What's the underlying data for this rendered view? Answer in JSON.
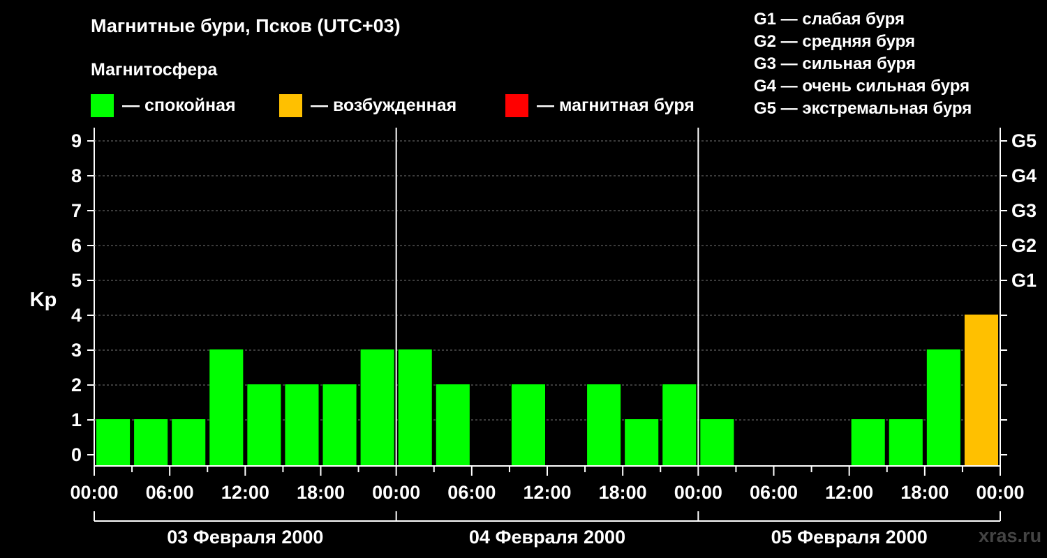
{
  "title": "Магнитные бури, Псков (UTC+03)",
  "subtitle": "Магнитосфера",
  "legend": [
    {
      "label": "— спокойная",
      "color": "#00ff00"
    },
    {
      "label": "— возбужденная",
      "color": "#ffc000"
    },
    {
      "label": "— магнитная буря",
      "color": "#ff0000"
    }
  ],
  "g_legend": [
    "G1 — слабая буря",
    "G2 — средняя буря",
    "G3 — сильная буря",
    "G4 — очень сильная буря",
    "G5 — экстремальная буря"
  ],
  "watermark": "xras.ru",
  "chart_data": {
    "type": "bar",
    "ylabel": "Kp",
    "ylim": [
      0,
      9
    ],
    "y_ticks": [
      "0",
      "1",
      "2",
      "3",
      "4",
      "5",
      "6",
      "7",
      "8",
      "9"
    ],
    "g_ticks": [
      {
        "value": 5,
        "label": "G1"
      },
      {
        "value": 6,
        "label": "G2"
      },
      {
        "value": 7,
        "label": "G3"
      },
      {
        "value": 8,
        "label": "G4"
      },
      {
        "value": 9,
        "label": "G5"
      }
    ],
    "x_tick_labels": [
      "00:00",
      "06:00",
      "12:00",
      "18:00",
      "00:00",
      "06:00",
      "12:00",
      "18:00",
      "00:00",
      "06:00",
      "12:00",
      "18:00",
      "00:00"
    ],
    "days": [
      "03 Февраля 2000",
      "04 Февраля 2000",
      "05 Февраля 2000"
    ],
    "interval_hours": 3,
    "values": [
      1,
      1,
      1,
      3,
      2,
      2,
      2,
      3,
      3,
      2,
      0,
      2,
      0,
      2,
      1,
      2,
      1,
      0,
      0,
      0,
      1,
      1,
      3,
      4
    ],
    "colors": [
      "#00ff00",
      "#00ff00",
      "#00ff00",
      "#00ff00",
      "#00ff00",
      "#00ff00",
      "#00ff00",
      "#00ff00",
      "#00ff00",
      "#00ff00",
      "#00ff00",
      "#00ff00",
      "#00ff00",
      "#00ff00",
      "#00ff00",
      "#00ff00",
      "#00ff00",
      "#00ff00",
      "#00ff00",
      "#00ff00",
      "#00ff00",
      "#00ff00",
      "#00ff00",
      "#ffc000"
    ],
    "grid": true
  }
}
